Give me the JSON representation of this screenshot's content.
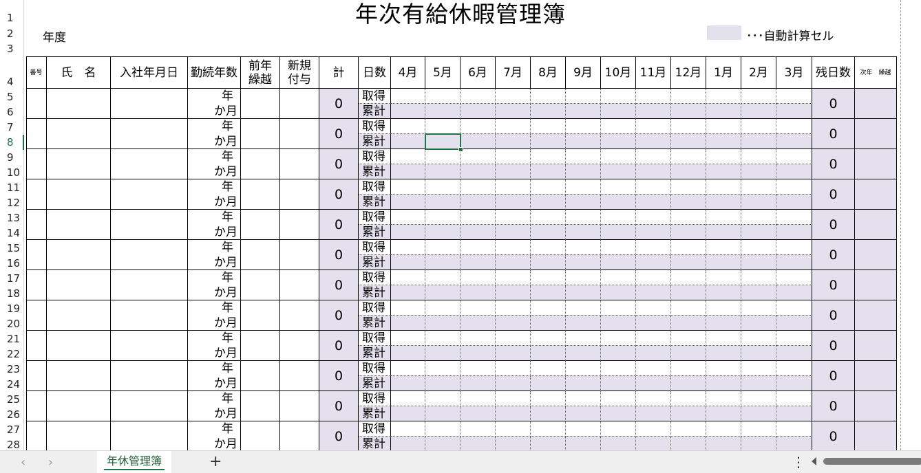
{
  "sheet": {
    "title": "年次有給休暇管理簿",
    "year_label": "年度",
    "legend": {
      "text": "･･･自動計算セル",
      "swatch_color": "#e4e0ee"
    },
    "row_numbers": [
      "1",
      "2",
      "3",
      "4",
      "5",
      "6",
      "7",
      "8",
      "9",
      "10",
      "11",
      "12",
      "13",
      "14",
      "15",
      "16",
      "17",
      "18",
      "19",
      "20",
      "21",
      "22",
      "23",
      "24",
      "25",
      "26",
      "27",
      "28"
    ],
    "active_row": "8",
    "headers": {
      "number": "番号",
      "name": "氏　名",
      "hire_date": "入社年月日",
      "tenure": "勤続年数",
      "carryover_prev": [
        "前年",
        "繰越"
      ],
      "new_grant": [
        "新規",
        "付与"
      ],
      "total": "計",
      "days": "日数",
      "months": [
        "4月",
        "5月",
        "6月",
        "7月",
        "8月",
        "9月",
        "10月",
        "11月",
        "12月",
        "1月",
        "2月",
        "3月"
      ],
      "remaining": "残日数",
      "next_carryover": "次年　繰越"
    },
    "record_labels": {
      "year": "年",
      "month": "か月",
      "taken": "取得",
      "cumulative": "累計"
    },
    "records": [
      {
        "total": "0",
        "remaining": "0"
      },
      {
        "total": "0",
        "remaining": "0"
      },
      {
        "total": "0",
        "remaining": "0"
      },
      {
        "total": "0",
        "remaining": "0"
      },
      {
        "total": "0",
        "remaining": "0"
      },
      {
        "total": "0",
        "remaining": "0"
      },
      {
        "total": "0",
        "remaining": "0"
      },
      {
        "total": "0",
        "remaining": "0"
      },
      {
        "total": "0",
        "remaining": "0"
      },
      {
        "total": "0",
        "remaining": "0"
      },
      {
        "total": "0",
        "remaining": "0"
      },
      {
        "total": "0",
        "remaining": "0"
      }
    ],
    "colors": {
      "auto_cell": "#e4e0ee",
      "selection": "#217346"
    }
  },
  "tabs": {
    "active_tab": "年休管理簿",
    "add_icon": "plus-icon",
    "prev_icon": "chevron-left-icon",
    "next_icon": "chevron-right-icon",
    "more_icon": "vertical-ellipsis-icon"
  }
}
